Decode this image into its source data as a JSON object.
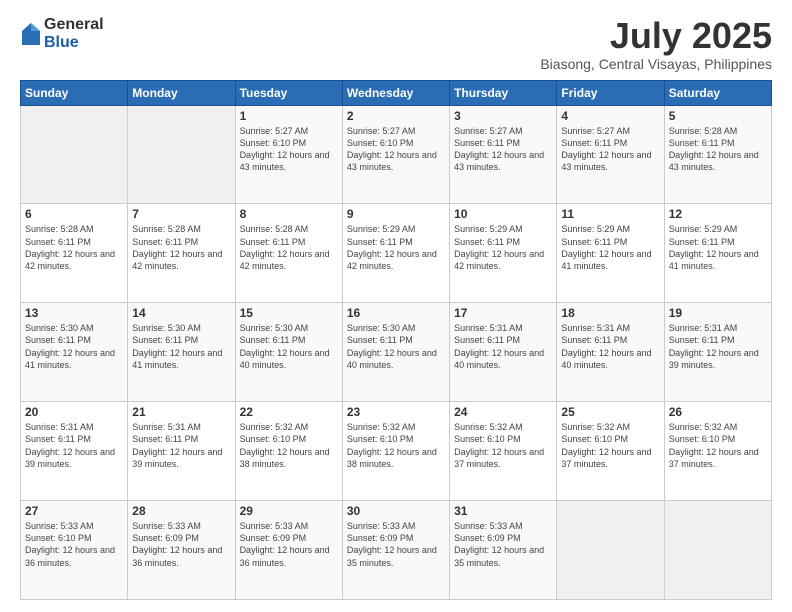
{
  "logo": {
    "general": "General",
    "blue": "Blue"
  },
  "header": {
    "month": "July 2025",
    "location": "Biasong, Central Visayas, Philippines"
  },
  "weekdays": [
    "Sunday",
    "Monday",
    "Tuesday",
    "Wednesday",
    "Thursday",
    "Friday",
    "Saturday"
  ],
  "weeks": [
    [
      {
        "day": "",
        "info": ""
      },
      {
        "day": "",
        "info": ""
      },
      {
        "day": "1",
        "info": "Sunrise: 5:27 AM\nSunset: 6:10 PM\nDaylight: 12 hours and 43 minutes."
      },
      {
        "day": "2",
        "info": "Sunrise: 5:27 AM\nSunset: 6:10 PM\nDaylight: 12 hours and 43 minutes."
      },
      {
        "day": "3",
        "info": "Sunrise: 5:27 AM\nSunset: 6:11 PM\nDaylight: 12 hours and 43 minutes."
      },
      {
        "day": "4",
        "info": "Sunrise: 5:27 AM\nSunset: 6:11 PM\nDaylight: 12 hours and 43 minutes."
      },
      {
        "day": "5",
        "info": "Sunrise: 5:28 AM\nSunset: 6:11 PM\nDaylight: 12 hours and 43 minutes."
      }
    ],
    [
      {
        "day": "6",
        "info": "Sunrise: 5:28 AM\nSunset: 6:11 PM\nDaylight: 12 hours and 42 minutes."
      },
      {
        "day": "7",
        "info": "Sunrise: 5:28 AM\nSunset: 6:11 PM\nDaylight: 12 hours and 42 minutes."
      },
      {
        "day": "8",
        "info": "Sunrise: 5:28 AM\nSunset: 6:11 PM\nDaylight: 12 hours and 42 minutes."
      },
      {
        "day": "9",
        "info": "Sunrise: 5:29 AM\nSunset: 6:11 PM\nDaylight: 12 hours and 42 minutes."
      },
      {
        "day": "10",
        "info": "Sunrise: 5:29 AM\nSunset: 6:11 PM\nDaylight: 12 hours and 42 minutes."
      },
      {
        "day": "11",
        "info": "Sunrise: 5:29 AM\nSunset: 6:11 PM\nDaylight: 12 hours and 41 minutes."
      },
      {
        "day": "12",
        "info": "Sunrise: 5:29 AM\nSunset: 6:11 PM\nDaylight: 12 hours and 41 minutes."
      }
    ],
    [
      {
        "day": "13",
        "info": "Sunrise: 5:30 AM\nSunset: 6:11 PM\nDaylight: 12 hours and 41 minutes."
      },
      {
        "day": "14",
        "info": "Sunrise: 5:30 AM\nSunset: 6:11 PM\nDaylight: 12 hours and 41 minutes."
      },
      {
        "day": "15",
        "info": "Sunrise: 5:30 AM\nSunset: 6:11 PM\nDaylight: 12 hours and 40 minutes."
      },
      {
        "day": "16",
        "info": "Sunrise: 5:30 AM\nSunset: 6:11 PM\nDaylight: 12 hours and 40 minutes."
      },
      {
        "day": "17",
        "info": "Sunrise: 5:31 AM\nSunset: 6:11 PM\nDaylight: 12 hours and 40 minutes."
      },
      {
        "day": "18",
        "info": "Sunrise: 5:31 AM\nSunset: 6:11 PM\nDaylight: 12 hours and 40 minutes."
      },
      {
        "day": "19",
        "info": "Sunrise: 5:31 AM\nSunset: 6:11 PM\nDaylight: 12 hours and 39 minutes."
      }
    ],
    [
      {
        "day": "20",
        "info": "Sunrise: 5:31 AM\nSunset: 6:11 PM\nDaylight: 12 hours and 39 minutes."
      },
      {
        "day": "21",
        "info": "Sunrise: 5:31 AM\nSunset: 6:11 PM\nDaylight: 12 hours and 39 minutes."
      },
      {
        "day": "22",
        "info": "Sunrise: 5:32 AM\nSunset: 6:10 PM\nDaylight: 12 hours and 38 minutes."
      },
      {
        "day": "23",
        "info": "Sunrise: 5:32 AM\nSunset: 6:10 PM\nDaylight: 12 hours and 38 minutes."
      },
      {
        "day": "24",
        "info": "Sunrise: 5:32 AM\nSunset: 6:10 PM\nDaylight: 12 hours and 37 minutes."
      },
      {
        "day": "25",
        "info": "Sunrise: 5:32 AM\nSunset: 6:10 PM\nDaylight: 12 hours and 37 minutes."
      },
      {
        "day": "26",
        "info": "Sunrise: 5:32 AM\nSunset: 6:10 PM\nDaylight: 12 hours and 37 minutes."
      }
    ],
    [
      {
        "day": "27",
        "info": "Sunrise: 5:33 AM\nSunset: 6:10 PM\nDaylight: 12 hours and 36 minutes."
      },
      {
        "day": "28",
        "info": "Sunrise: 5:33 AM\nSunset: 6:09 PM\nDaylight: 12 hours and 36 minutes."
      },
      {
        "day": "29",
        "info": "Sunrise: 5:33 AM\nSunset: 6:09 PM\nDaylight: 12 hours and 36 minutes."
      },
      {
        "day": "30",
        "info": "Sunrise: 5:33 AM\nSunset: 6:09 PM\nDaylight: 12 hours and 35 minutes."
      },
      {
        "day": "31",
        "info": "Sunrise: 5:33 AM\nSunset: 6:09 PM\nDaylight: 12 hours and 35 minutes."
      },
      {
        "day": "",
        "info": ""
      },
      {
        "day": "",
        "info": ""
      }
    ]
  ]
}
